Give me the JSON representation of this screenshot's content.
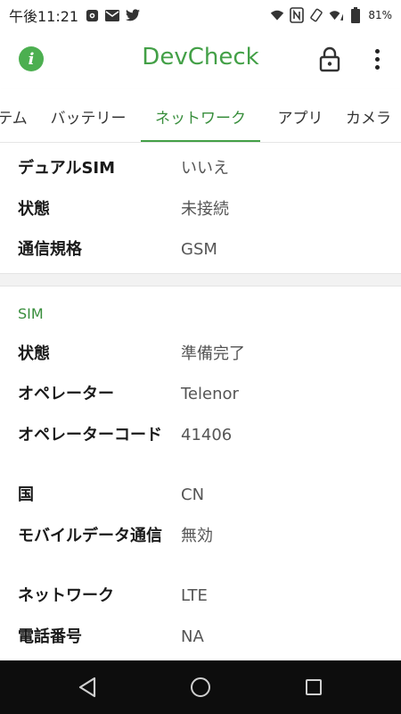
{
  "status_bar": {
    "time": "午後11:21",
    "battery_percent": "81%",
    "left_icons": [
      "settings-gear-icon",
      "mail-icon",
      "twitter-icon"
    ],
    "right_icons": [
      "wifi-icon",
      "nfc-icon",
      "vibrate-icon",
      "signal-icon",
      "battery-icon"
    ]
  },
  "app_bar": {
    "title": "DevCheck",
    "accent_color": "#43a047"
  },
  "tabs": [
    {
      "label": "テム"
    },
    {
      "label": "バッテリー"
    },
    {
      "label": "ネットワーク",
      "active": true
    },
    {
      "label": "アプリ"
    },
    {
      "label": "カメラ"
    }
  ],
  "card1": {
    "rows": [
      {
        "label": "デュアルSIM",
        "value": "いいえ"
      },
      {
        "label": "状態",
        "value": "未接続"
      },
      {
        "label": "通信規格",
        "value": "GSM"
      }
    ]
  },
  "sim": {
    "title": "SIM",
    "rows": [
      {
        "label": "状態",
        "value": "準備完了"
      },
      {
        "label": "オペレーター",
        "value": "Telenor"
      },
      {
        "label": "オペレーターコード",
        "value": "41406"
      },
      {
        "label": "国",
        "value": "CN"
      },
      {
        "label": "モバイルデータ通信",
        "value": "無効"
      },
      {
        "label": "ネットワーク",
        "value": "LTE"
      },
      {
        "label": "電話番号",
        "value": "NA"
      }
    ]
  }
}
